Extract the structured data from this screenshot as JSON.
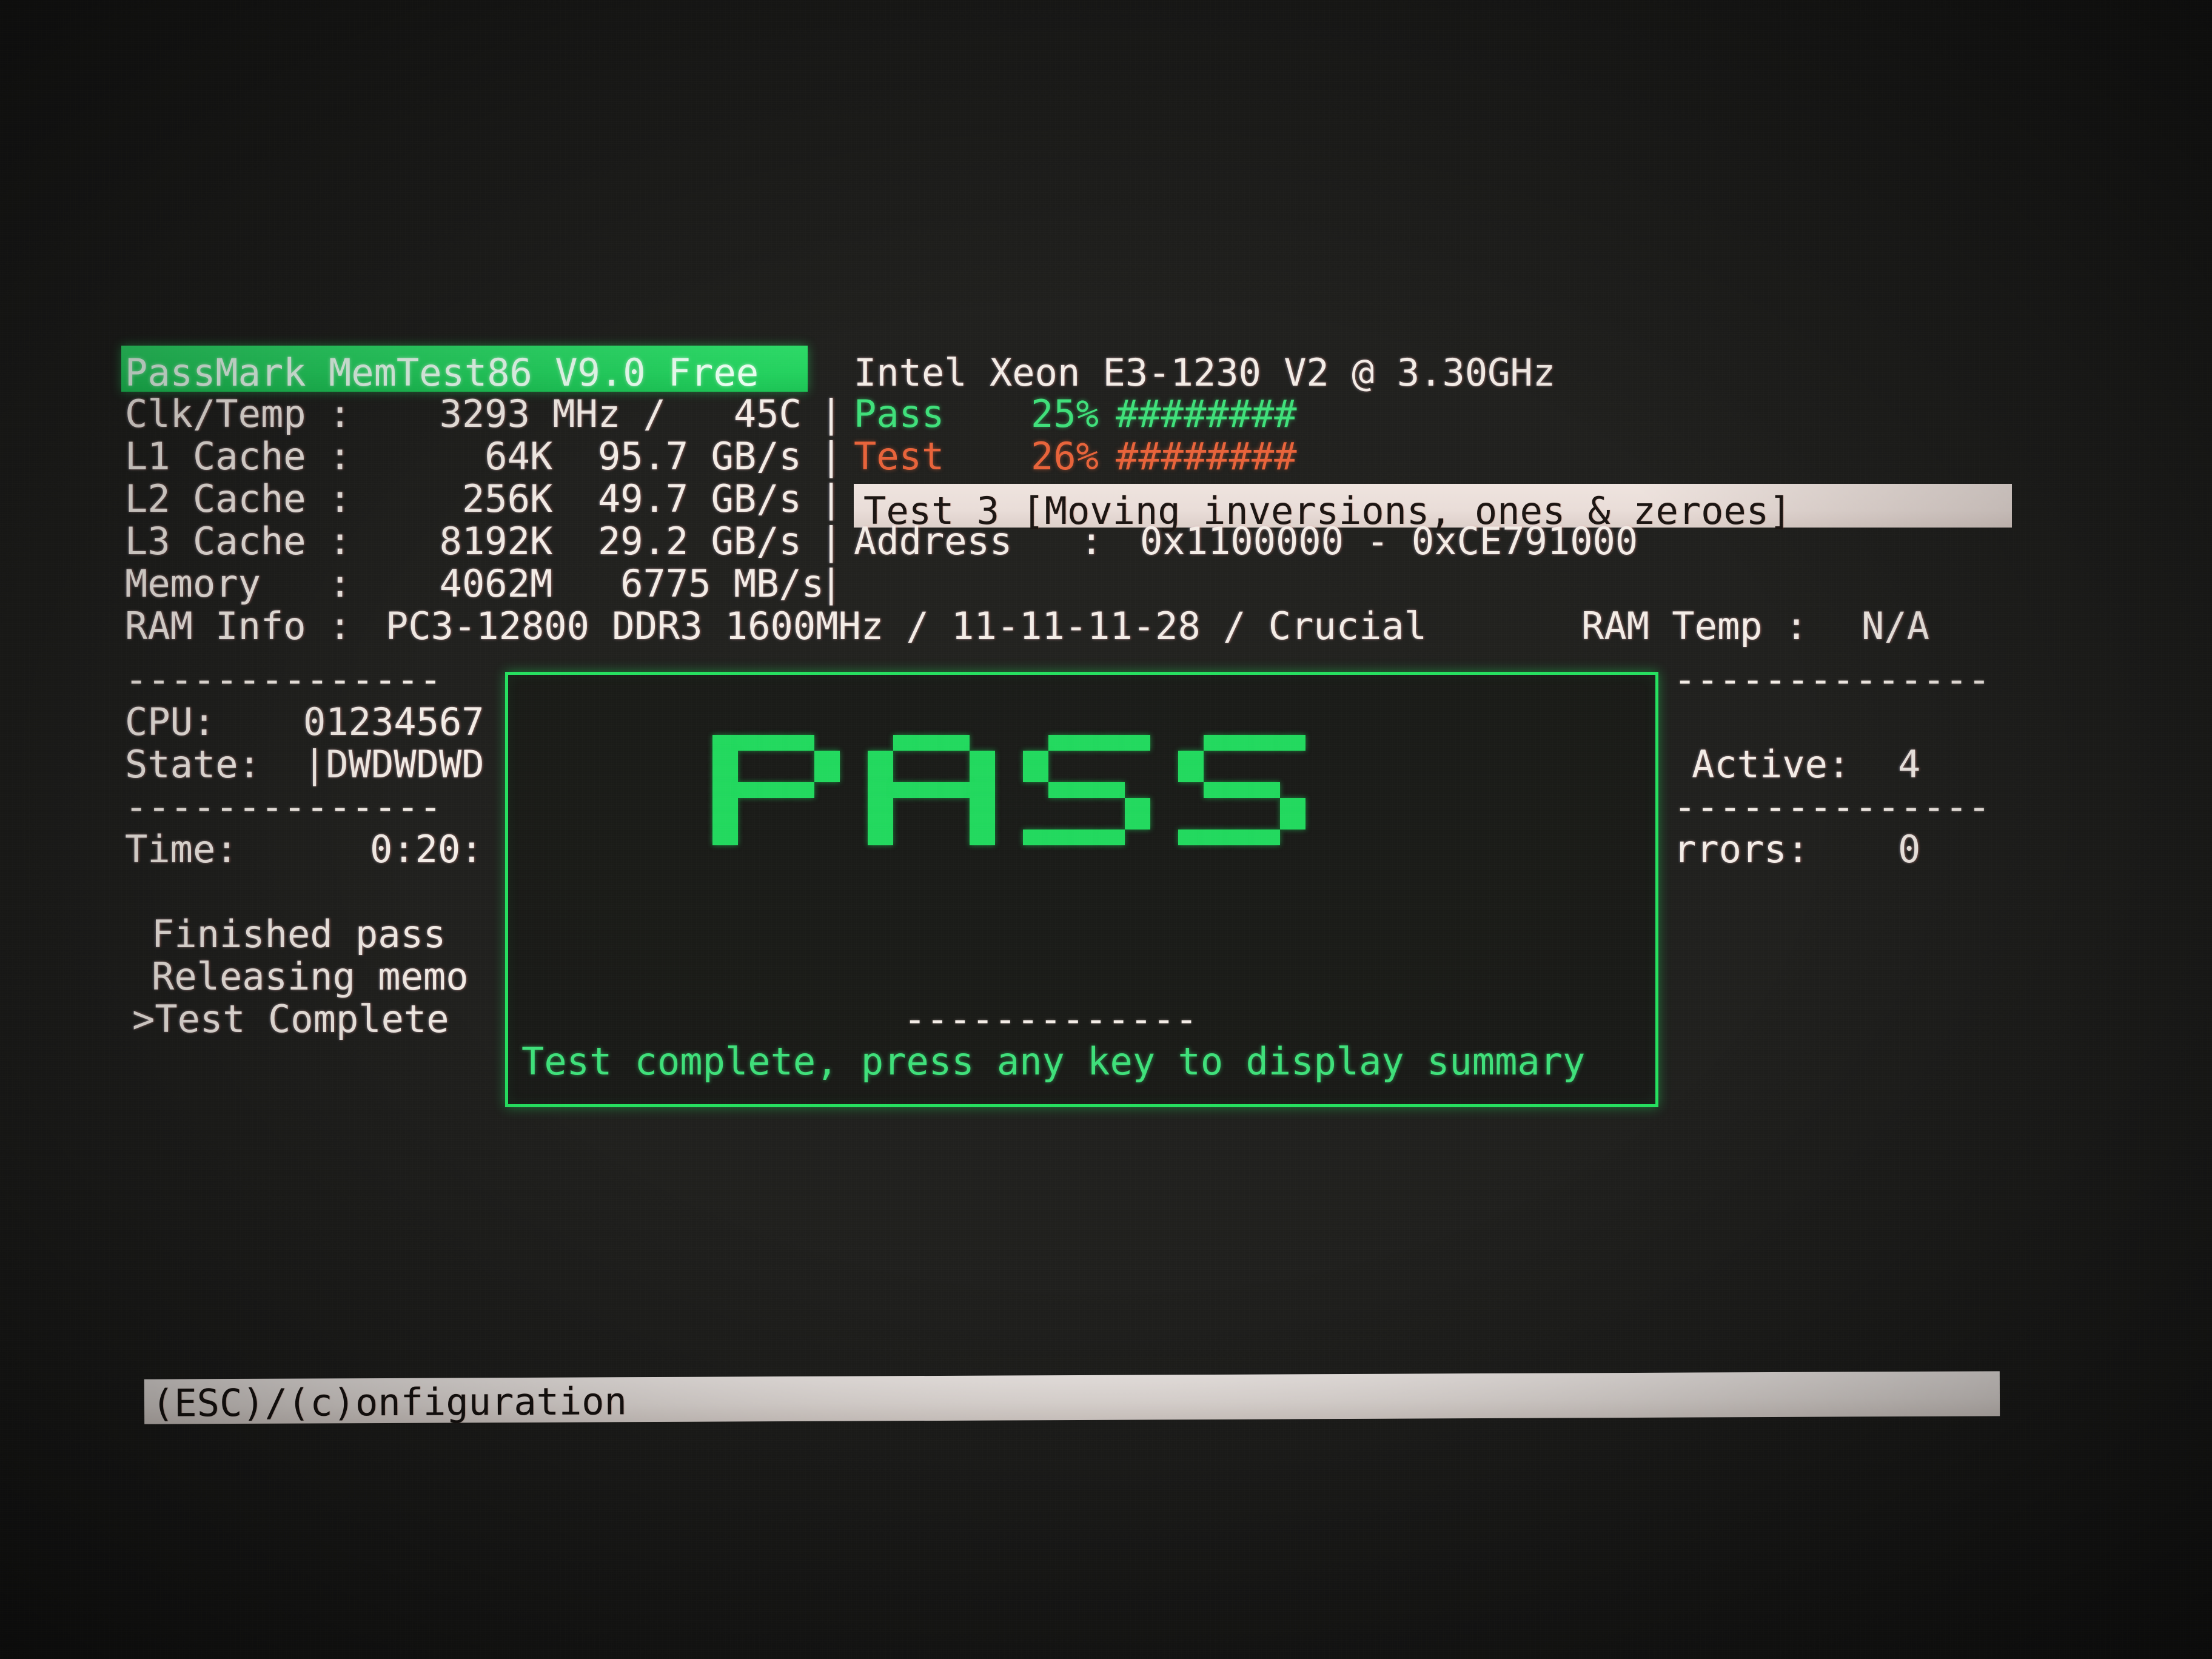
{
  "app": {
    "title": "PassMark MemTest86 V9.0 Free",
    "cpu": "Intel Xeon E3-1230 V2 @ 3.30GHz"
  },
  "sysinfo": {
    "rows": [
      {
        "label": "Clk/Temp :",
        "value": "  3293 MHz /   45C"
      },
      {
        "label": "L1 Cache :",
        "value": "    64K  95.7 GB/s"
      },
      {
        "label": "L2 Cache :",
        "value": "   256K  49.7 GB/s"
      },
      {
        "label": "L3 Cache :",
        "value": "  8192K  29.2 GB/s"
      },
      {
        "label": "Memory   :",
        "value": "  4062M   6775 MB/s"
      }
    ],
    "ram_info_label": "RAM Info :",
    "ram_info_value": "PC3-12800 DDR3 1600MHz / 11-11-11-28 / Crucial",
    "ram_temp_label": "RAM Temp :",
    "ram_temp_value": "N/A"
  },
  "progress": {
    "pass_label": "Pass",
    "pass_percent": "25%",
    "pass_bar": "########",
    "test_label": "Test",
    "test_percent": "26%",
    "test_bar": "########",
    "test_name": "Test 3 [Moving inversions, ones & zeroes]",
    "address_label": "Address   :",
    "address_value": "0x1100000 - 0xCE791000"
  },
  "cpu_panel": {
    "divider": "--------------",
    "cpu_label": "CPU:",
    "cpu_value": "01234567",
    "state_label": "State:",
    "state_value": "|DWDWDWD",
    "time_label": "Time:",
    "time_value": "0:20:",
    "active_label": "Active:",
    "active_value": "4",
    "errors_label": "rrors:",
    "errors_value": "0"
  },
  "log": {
    "lines": [
      "Finished pass",
      "Releasing memo",
      ">Test Complete"
    ]
  },
  "result": {
    "word": "PASS",
    "separator": "-------------",
    "message": "Test complete, press any key to display summary"
  },
  "footer": {
    "hint": "(ESC)/(c)onfiguration"
  },
  "colors": {
    "pass_green": "#22d95e",
    "title_bg": "#2ddc68",
    "test_orange": "#e8633a",
    "highlight_cream": "#efe4df",
    "text": "#f3ece6"
  },
  "glyph_map": {
    "P": [
      "11110",
      "10001",
      "10001",
      "11110",
      "10000",
      "10000",
      "10000"
    ],
    "A": [
      "01110",
      "10001",
      "10001",
      "11111",
      "10001",
      "10001",
      "10001"
    ],
    "S": [
      "01111",
      "10000",
      "10000",
      "01110",
      "00001",
      "00001",
      "11110"
    ]
  }
}
